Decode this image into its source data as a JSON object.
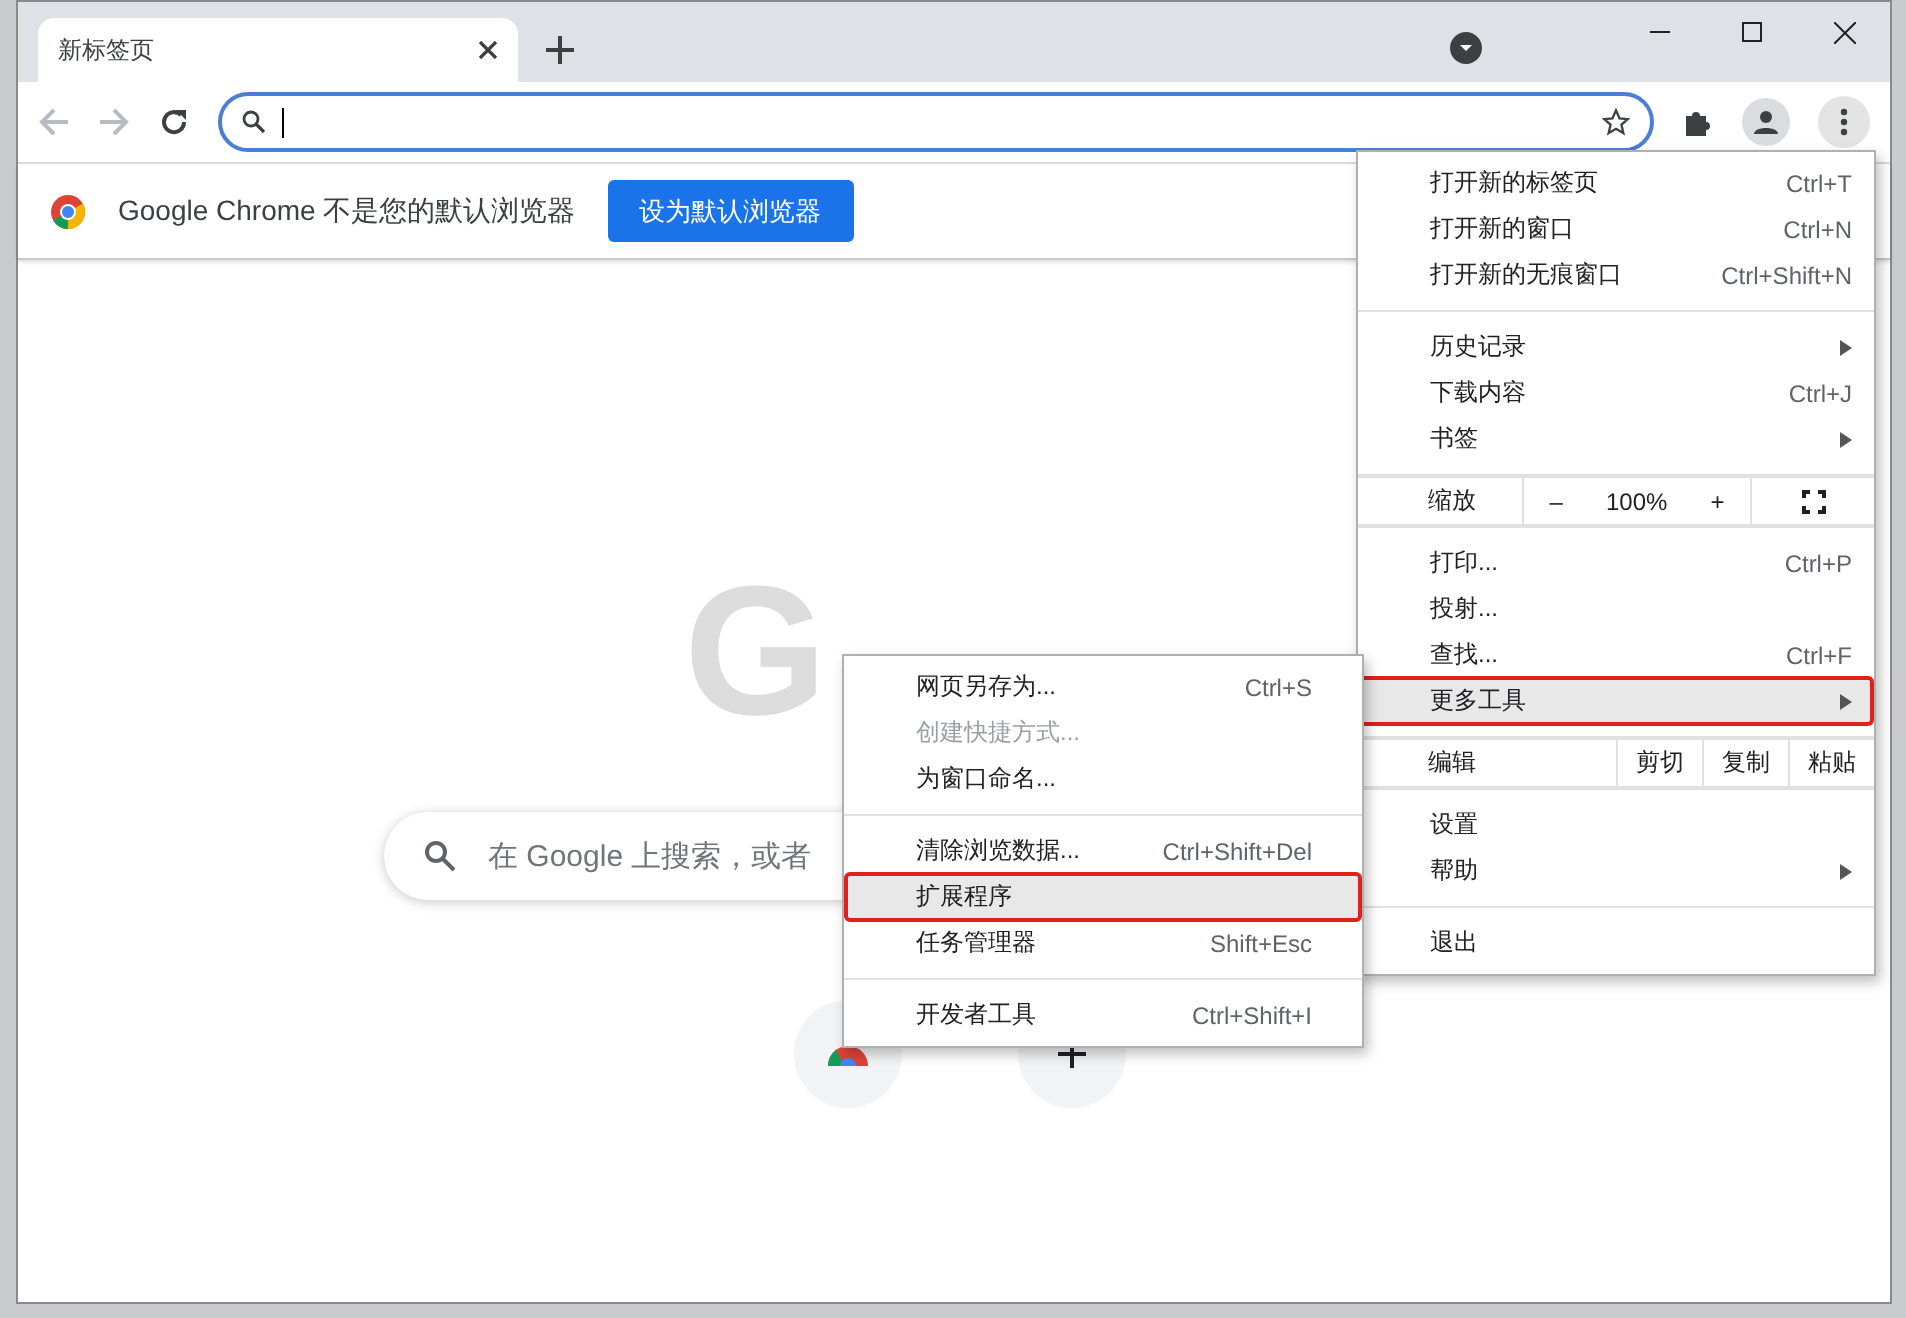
{
  "tabs": [
    {
      "title": "新标签页",
      "selected": true
    }
  ],
  "infobar": {
    "message": "Google Chrome 不是您的默认浏览器",
    "button": "设为默认浏览器"
  },
  "new_tab_page": {
    "logo": "G",
    "search": {
      "placeholder": "在 Google 上搜索，或者"
    }
  },
  "menu": {
    "sections": [
      [
        {
          "kind": "item",
          "label": "打开新的标签页",
          "shortcut": "Ctrl+T",
          "submenu": false,
          "highlighted": false
        },
        {
          "kind": "item",
          "label": "打开新的窗口",
          "shortcut": "Ctrl+N",
          "submenu": false,
          "highlighted": false
        },
        {
          "kind": "item",
          "label": "打开新的无痕窗口",
          "shortcut": "Ctrl+Shift+N",
          "submenu": false,
          "highlighted": false
        }
      ],
      [
        {
          "kind": "item",
          "label": "历史记录",
          "submenu": true,
          "highlighted": false
        },
        {
          "kind": "item",
          "label": "下载内容",
          "shortcut": "Ctrl+J",
          "submenu": false,
          "highlighted": false
        },
        {
          "kind": "item",
          "label": "书签",
          "submenu": true,
          "highlighted": false
        }
      ],
      [
        {
          "kind": "zoom",
          "label": "缩放",
          "minus": "–",
          "value": "100%",
          "plus": "+"
        }
      ],
      [
        {
          "kind": "item",
          "label": "打印...",
          "shortcut": "Ctrl+P",
          "submenu": false,
          "highlighted": false
        },
        {
          "kind": "item",
          "label": "投射...",
          "submenu": false,
          "highlighted": false
        },
        {
          "kind": "item",
          "label": "查找...",
          "shortcut": "Ctrl+F",
          "submenu": false,
          "highlighted": false
        },
        {
          "kind": "item",
          "label": "更多工具",
          "submenu": true,
          "highlighted": true
        }
      ],
      [
        {
          "kind": "edit",
          "label": "编辑",
          "buttons": [
            "剪切",
            "复制",
            "粘贴"
          ]
        }
      ],
      [
        {
          "kind": "item",
          "label": "设置",
          "submenu": false,
          "highlighted": false
        },
        {
          "kind": "item",
          "label": "帮助",
          "submenu": true,
          "highlighted": false
        }
      ],
      [
        {
          "kind": "item",
          "label": "退出",
          "submenu": false,
          "highlighted": false
        }
      ]
    ]
  },
  "submenu": {
    "sections": [
      [
        {
          "label": "网页另存为...",
          "shortcut": "Ctrl+S",
          "disabled": false,
          "highlighted": false
        },
        {
          "label": "创建快捷方式...",
          "disabled": true,
          "highlighted": false
        },
        {
          "label": "为窗口命名...",
          "disabled": false,
          "highlighted": false
        }
      ],
      [
        {
          "label": "清除浏览数据...",
          "shortcut": "Ctrl+Shift+Del",
          "disabled": false,
          "highlighted": false
        },
        {
          "label": "扩展程序",
          "disabled": false,
          "highlighted": true
        },
        {
          "label": "任务管理器",
          "shortcut": "Shift+Esc",
          "disabled": false,
          "highlighted": false
        }
      ],
      [
        {
          "label": "开发者工具",
          "shortcut": "Ctrl+Shift+I",
          "disabled": false,
          "highlighted": false
        }
      ]
    ]
  }
}
